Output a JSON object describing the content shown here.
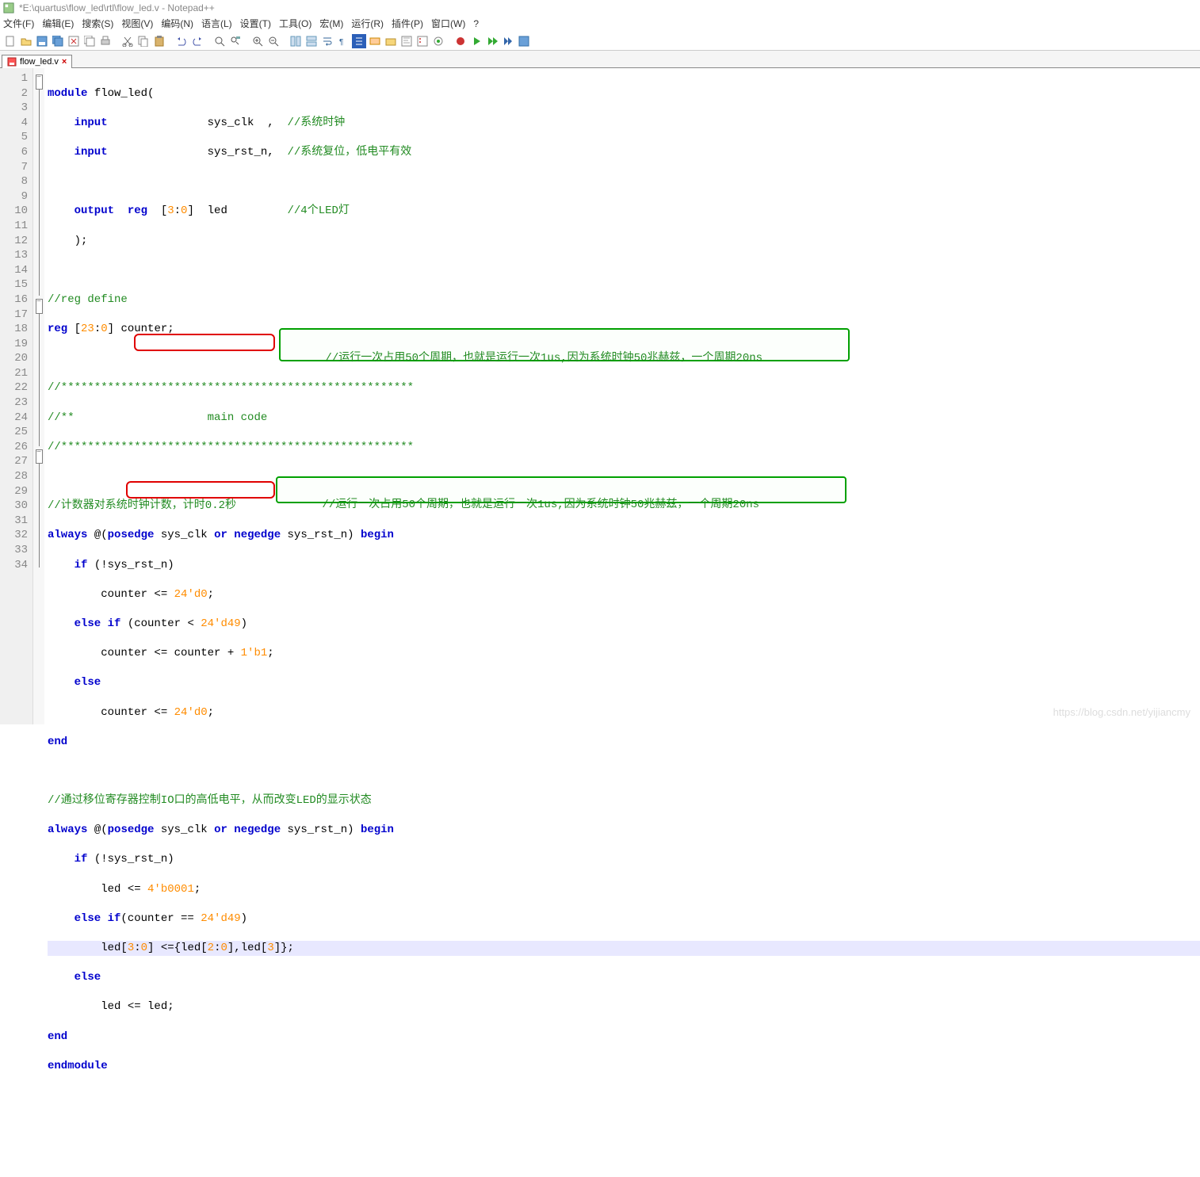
{
  "title": "*E:\\quartus\\flow_led\\rtl\\flow_led.v - Notepad++",
  "menu": {
    "file": "文件(F)",
    "edit": "编辑(E)",
    "search": "搜索(S)",
    "view": "视图(V)",
    "encoding": "编码(N)",
    "lang": "语言(L)",
    "settings": "设置(T)",
    "tools": "工具(O)",
    "macro": "宏(M)",
    "run": "运行(R)",
    "plugins": "插件(P)",
    "window": "窗口(W)",
    "help": "?"
  },
  "tab": {
    "name": "flow_led.v",
    "close": "×"
  },
  "annotations": {
    "a1": "//运行一次占用50个周期，也就是运行一次1us,因为系统时钟50兆赫兹，一个周期20ns",
    "a2": "//运行一次占用50个周期，也就是运行一次1us,因为系统时钟50兆赫兹，一个周期20ns"
  },
  "code": {
    "l1": {
      "a": "module",
      "b": " flow_led("
    },
    "l2": {
      "a": "    input",
      "b": "               sys_clk  ,  ",
      "c": "//系统时钟"
    },
    "l3": {
      "a": "    input",
      "b": "               sys_rst_n,  ",
      "c": "//系统复位，低电平有效"
    },
    "l4": {
      "a": " "
    },
    "l5": {
      "a": "    output",
      "b": "  reg  ",
      "c": "[",
      "d": "3",
      "e": ":",
      "f": "0",
      "g": "]  led         ",
      "h": "//4个LED灯"
    },
    "l6": {
      "a": "    );"
    },
    "l7": {
      "a": " "
    },
    "l8": {
      "a": "//reg define"
    },
    "l9": {
      "a": "reg ",
      "b": "[",
      "c": "23",
      "d": ":",
      "e": "0",
      "f": "] counter;"
    },
    "l10": {
      "a": " "
    },
    "l11": {
      "a": "//*****************************************************"
    },
    "l12": {
      "a": "//**                    main code"
    },
    "l13": {
      "a": "//*****************************************************"
    },
    "l14": {
      "a": " "
    },
    "l15": {
      "a": "//计数器对系统时钟计数，计时0.2秒"
    },
    "l16": {
      "a": "always",
      "b": " @(",
      "c": "posedge",
      "d": " sys_clk ",
      "e": "or",
      "f": " ",
      "g": "negedge",
      "h": " sys_rst_n) ",
      "i": "begin"
    },
    "l17": {
      "a": "    if",
      "b": " (!sys_rst_n)"
    },
    "l18": {
      "a": "        counter <= ",
      "b": "24'd0",
      "c": ";"
    },
    "l19": {
      "a": "    else if ",
      "b": "(counter < ",
      "c": "24'd49",
      "d": ")"
    },
    "l20": {
      "a": "        counter <= counter + ",
      "b": "1'b1",
      "c": ";"
    },
    "l21": {
      "a": "    else"
    },
    "l22": {
      "a": "        counter <= ",
      "b": "24'd0",
      "c": ";"
    },
    "l23": {
      "a": "end"
    },
    "l24": {
      "a": " "
    },
    "l25": {
      "a": "//通过移位寄存器控制IO口的高低电平，从而改变LED的显示状态"
    },
    "l26": {
      "a": "always",
      "b": " @(",
      "c": "posedge",
      "d": " sys_clk ",
      "e": "or",
      "f": " ",
      "g": "negedge",
      "h": " sys_rst_n) ",
      "i": "begin"
    },
    "l27": {
      "a": "    if",
      "b": " (!sys_rst_n)"
    },
    "l28": {
      "a": "        led <= ",
      "b": "4'b0001",
      "c": ";"
    },
    "l29": {
      "a": "    else if",
      "b": "(counter == ",
      "c": "24'd49",
      "d": ")"
    },
    "l30": {
      "a": "        led[",
      "b": "3",
      "c": ":",
      "d": "0",
      "e": "] <={led[",
      "f": "2",
      "g": ":",
      "h": "0",
      "i": "],led[",
      "j": "3",
      "k": "]};"
    },
    "l31": {
      "a": "    else"
    },
    "l32": {
      "a": "        led <= led;"
    },
    "l33": {
      "a": "end"
    },
    "l34": {
      "a": "endmodule"
    }
  },
  "watermark": "https://blog.csdn.net/yijiancmy"
}
